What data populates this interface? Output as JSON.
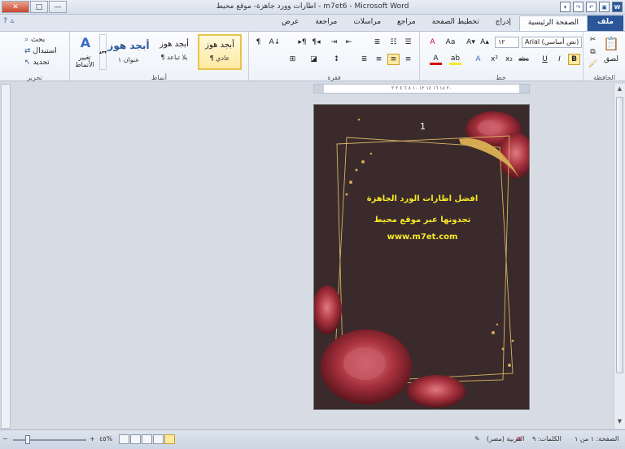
{
  "window": {
    "title": "اطارات وورد جاهزة- موقع محيط - m7et6 - Microsoft Word",
    "qat_word": "W",
    "min_glyph": "—",
    "max_glyph": "□",
    "close_glyph": "✕"
  },
  "tabs": {
    "file": "ملف",
    "items": [
      "الصفحة الرئيسية",
      "إدراج",
      "تخطيط الصفحة",
      "مراجع",
      "مراسلات",
      "مراجعة",
      "عرض"
    ],
    "help": "?"
  },
  "ribbon": {
    "clipboard": {
      "label": "الحافظة",
      "paste": "لصق"
    },
    "font": {
      "label": "خط",
      "font_name": "Arial (نص أساسي)",
      "font_size": "١٢",
      "bold": "B",
      "italic": "I",
      "underline": "U",
      "strike": "abc",
      "subscript": "x₂",
      "superscript": "x²",
      "grow": "A▴",
      "shrink": "A▾",
      "case": "Aa",
      "clear": "A",
      "highlight": "ab",
      "font_color": "A"
    },
    "paragraph": {
      "label": "فقرة",
      "pilcrow": "¶",
      "sort": "A↓"
    },
    "styles": {
      "label": "أنماط",
      "items": [
        {
          "sample": "أبجد هوز",
          "name": "¶ عادي"
        },
        {
          "sample": "أبجد هوز",
          "name": "¶ بلا تباعد"
        },
        {
          "sample": "أبجد هوز",
          "name": "عنوان ١"
        }
      ],
      "change_styles": "تغيير الأنماط",
      "change_icon": "A"
    },
    "editing": {
      "label": "تحرير",
      "find": "بحث",
      "replace": "استبدال",
      "select": "تحديد"
    }
  },
  "ruler": {
    "marks": "٢٠ ١٨ ١٦ ١٤ ١٢ ١٠ ٨ ٦ ٤ ٢ ٢"
  },
  "document": {
    "page_number": "1",
    "line1": "افضل اطارات الورد الجاهزة",
    "line2": "تجدونها عبر موقع محيط",
    "line3": "www.m7et.com"
  },
  "status": {
    "page": "الصفحة: ١ من ١",
    "words": "الكلمات: ٩",
    "language": "العربية (مصر)",
    "zoom": "٤٥%",
    "zoom_level": 0.45
  }
}
